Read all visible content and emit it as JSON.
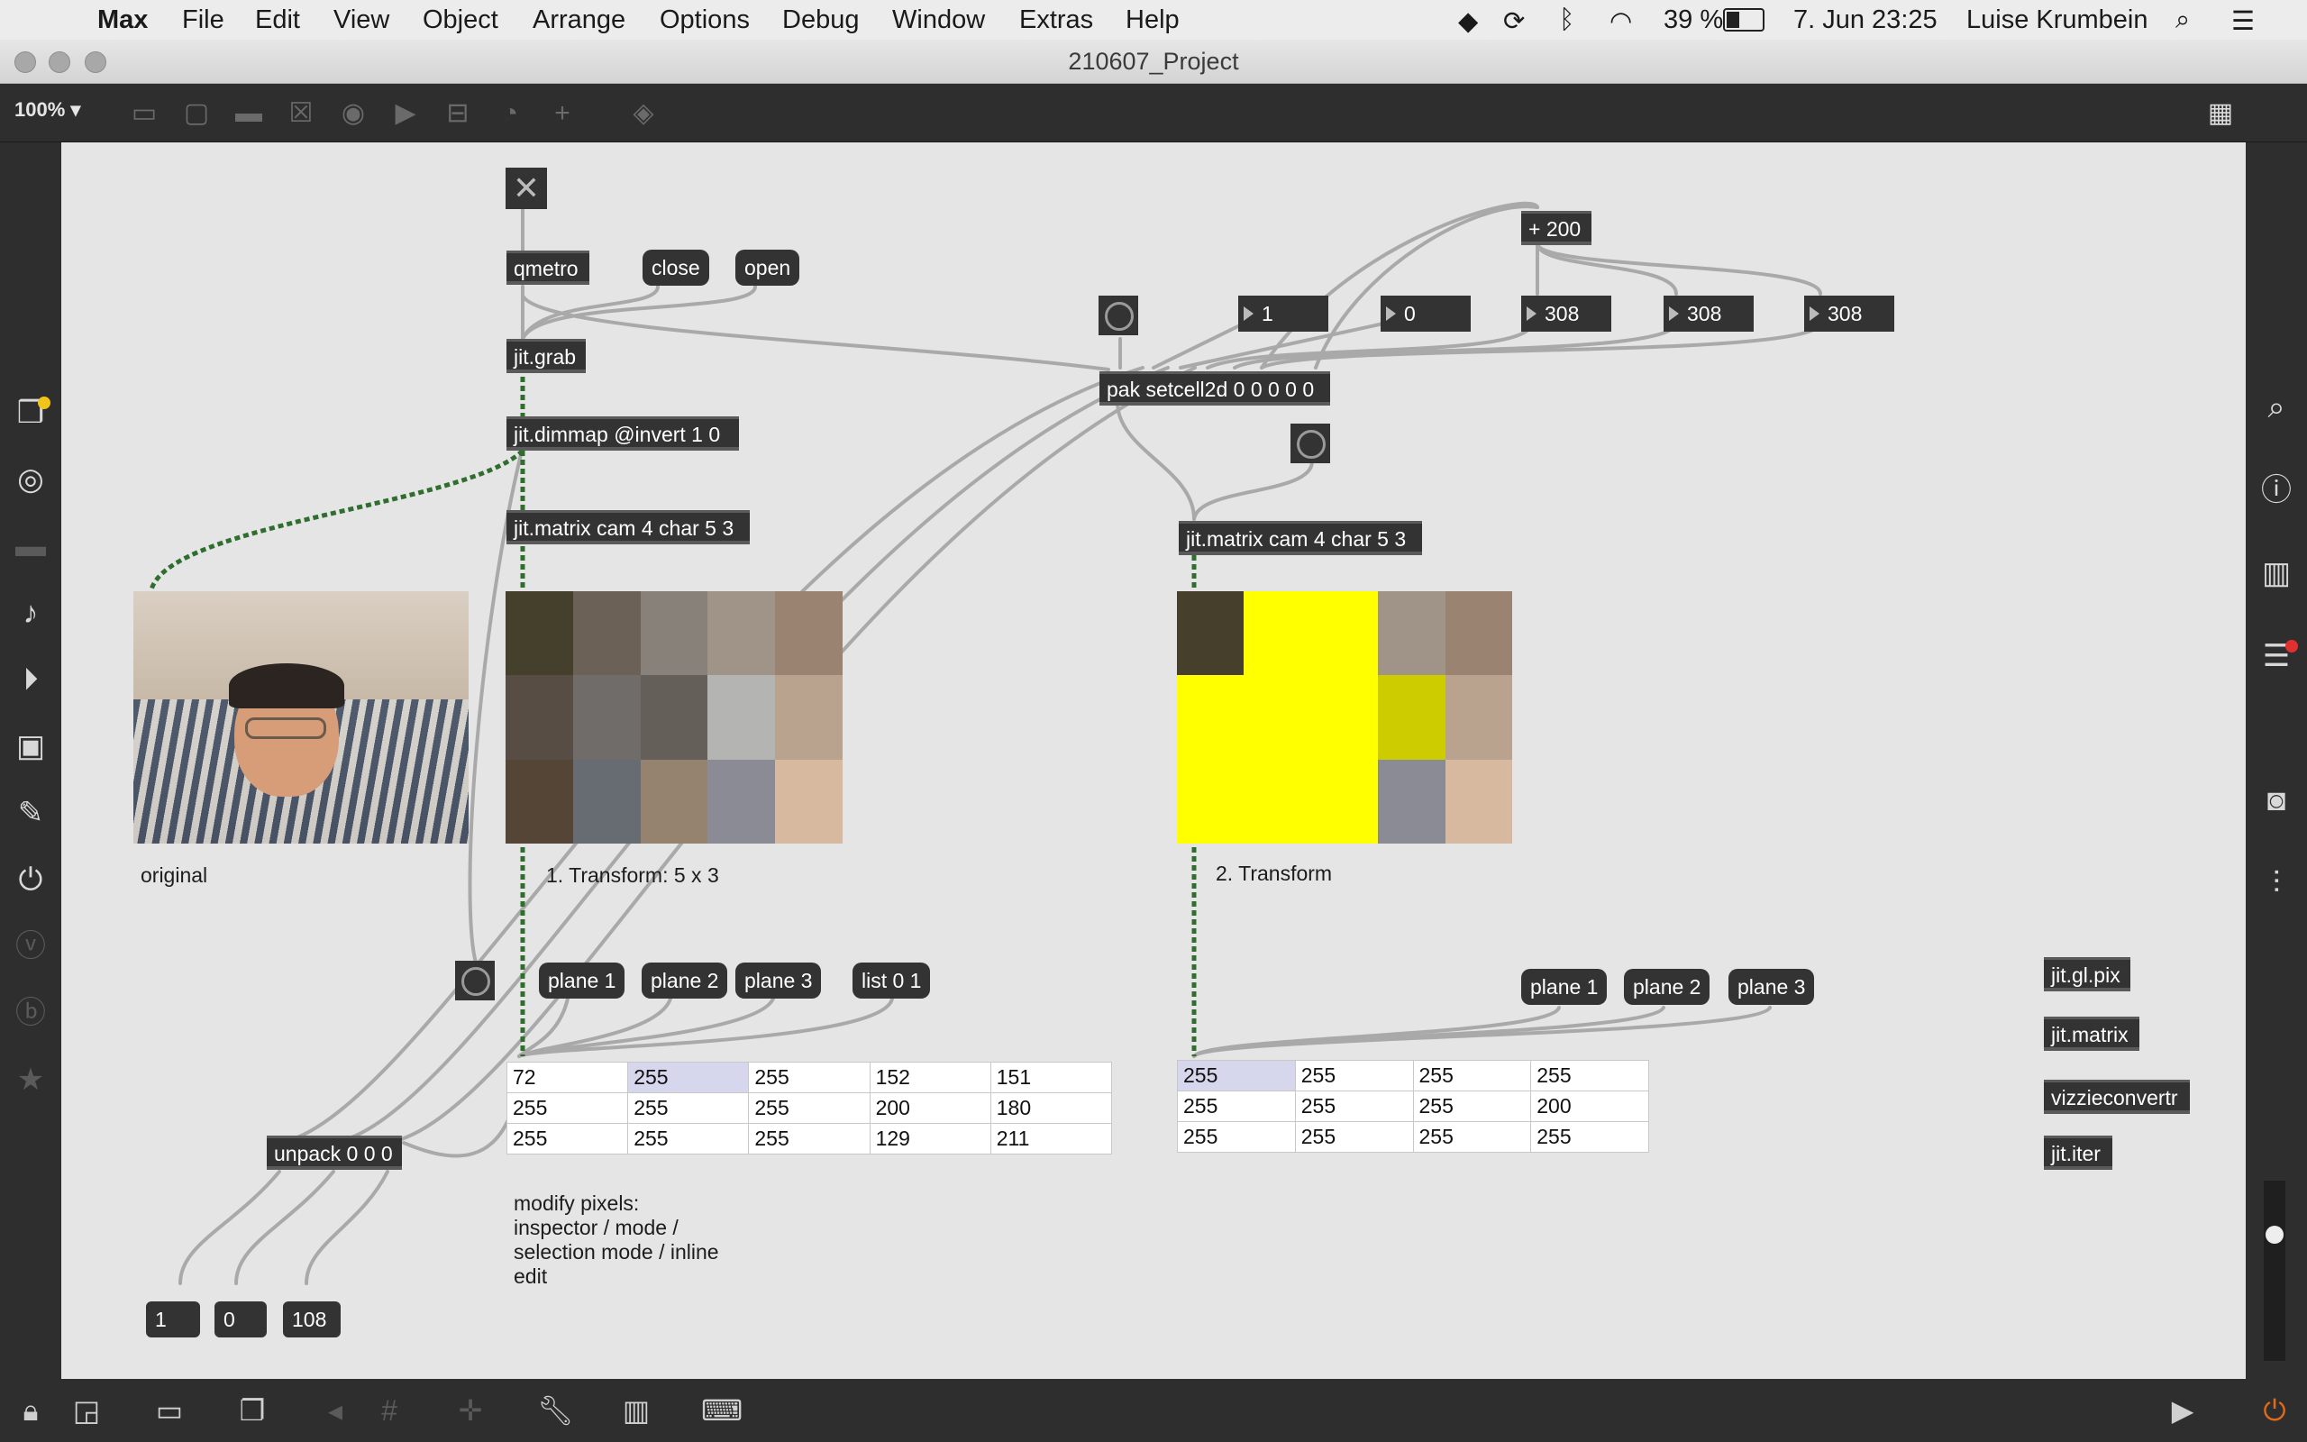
{
  "menubar": {
    "app": "Max",
    "items": [
      "File",
      "Edit",
      "View",
      "Object",
      "Arrange",
      "Options",
      "Debug",
      "Window",
      "Extras",
      "Help"
    ],
    "battery": "39 %",
    "datetime": "7. Jun  23:25",
    "user": "Luise Krumbein"
  },
  "window": {
    "title": "210607_Project"
  },
  "toolbar": {
    "zoom": "100%"
  },
  "patch": {
    "qmetro": "qmetro",
    "close": "close",
    "open": "open",
    "jit_grab": "jit.grab",
    "dimmap": "jit.dimmap @invert 1 0",
    "matrix1": "jit.matrix cam 4 char 5 3",
    "matrix2": "jit.matrix cam 4 char 5 3",
    "pak": "pak setcell2d 0 0 0 0 0",
    "plus": "+ 200",
    "numbers_top": [
      "1",
      "0",
      "308",
      "308",
      "308"
    ],
    "unpack": "unpack 0 0 0",
    "bottom_numbers": [
      "1",
      "0",
      "108"
    ],
    "planes_left": [
      "plane 1",
      "plane 2",
      "plane 3"
    ],
    "list_msg": "list 0 1",
    "planes_right": [
      "plane 1",
      "plane 2",
      "plane 3"
    ],
    "label_original": "original",
    "label_transform1": "1. Transform: 5 x 3",
    "label_transform2": "2. Transform",
    "label_modify": "modify pixels:\ninspector / mode /\nselection mode /  inline\nedit",
    "side_objects": [
      "jit.gl.pix",
      "jit.matrix",
      "vizzieconvertr",
      "jit.iter"
    ]
  },
  "cellblock1": {
    "rows": [
      [
        "72",
        "255",
        "255",
        "152",
        "151"
      ],
      [
        "255",
        "255",
        "255",
        "200",
        "180"
      ],
      [
        "255",
        "255",
        "255",
        "129",
        "211"
      ]
    ]
  },
  "cellblock2": {
    "rows": [
      [
        "255",
        "255",
        "255",
        "255"
      ],
      [
        "255",
        "255",
        "255",
        "200"
      ],
      [
        "255",
        "255",
        "255",
        "255"
      ]
    ]
  },
  "colors": {
    "pwindow1": [
      "#45402b",
      "#6b6157",
      "#88817a",
      "#a09488",
      "#9b8372",
      "#574d44",
      "#6f6c6a",
      "#646059",
      "#b4b4b2",
      "#b9a38e",
      "#544536",
      "#676c72",
      "#95826f",
      "#8a8b94",
      "#d7b99f"
    ],
    "pwindow2": [
      "#453f2c",
      "#ffff00",
      "#ffff00",
      "#a09488",
      "#9b8372",
      "#ffff00",
      "#ffff00",
      "#ffff00",
      "#cccc00",
      "#b9a38e",
      "#ffff00",
      "#ffff00",
      "#ffff00",
      "#8a8b94",
      "#d7b99f"
    ]
  }
}
